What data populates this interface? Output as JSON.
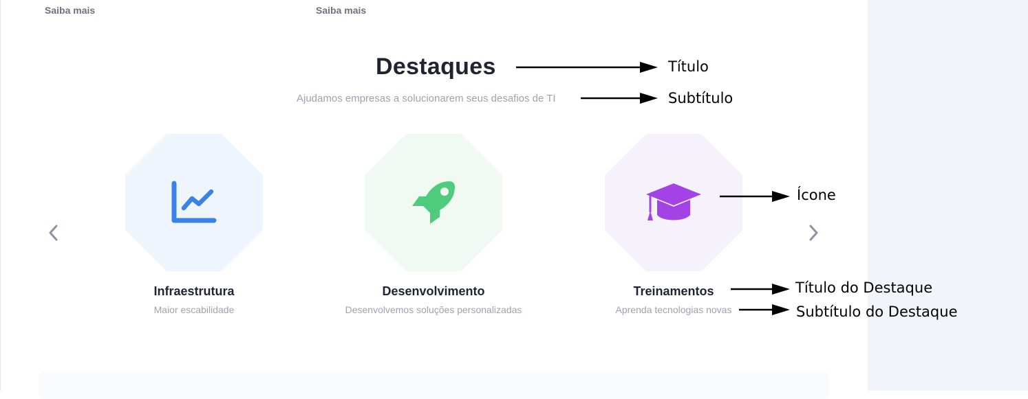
{
  "links": {
    "saiba_mais_1": "Saiba mais",
    "saiba_mais_2": "Saiba mais"
  },
  "section": {
    "title": "Destaques",
    "subtitle": "Ajudamos empresas a solucionarem seus desafios de TI"
  },
  "carousel": {
    "prev_icon": "chevron-left-icon",
    "next_icon": "chevron-right-icon",
    "items": [
      {
        "title": "Infraestrutura",
        "subtitle": "Maior escabilidade",
        "icon": "line-chart-icon",
        "icon_color": "#3b82e6",
        "bg_color": "#eff5fd"
      },
      {
        "title": "Desenvolvimento",
        "subtitle": "Desenvolvemos soluções personalizadas",
        "icon": "rocket-icon",
        "icon_color": "#4ecb7d",
        "bg_color": "#f1f9f3"
      },
      {
        "title": "Treinamentos",
        "subtitle": "Aprenda tecnologias novas",
        "icon": "graduation-cap-icon",
        "icon_color": "#a343e6",
        "bg_color": "#f6f2fc"
      }
    ]
  },
  "annotations": {
    "titulo": "Título",
    "subtitulo": "Subtítulo",
    "icone": "Ícone",
    "titulo_destaque": "Título do Destaque",
    "subtitulo_destaque": "Subtítulo do Destaque"
  },
  "colors": {
    "heading": "#1f2433",
    "muted": "#9ca3af",
    "side_panel": "#f1f5f9"
  }
}
